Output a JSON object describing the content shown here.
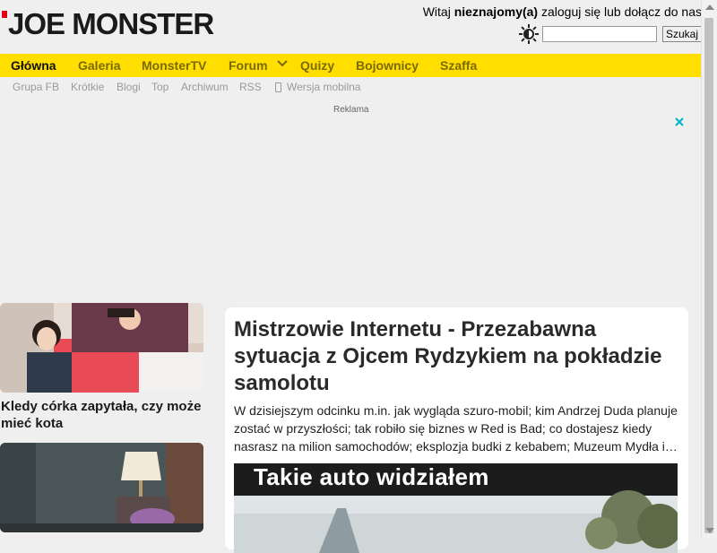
{
  "header": {
    "logo_text": "JOE MONSTER",
    "greeting_prefix": "Witaj",
    "user_name": "nieznajomy(a)",
    "greeting_login": "zaloguj się lub dołącz do nas",
    "search_placeholder": "",
    "search_button": "Szukaj"
  },
  "nav": {
    "items": [
      {
        "label": "Główna",
        "active": true
      },
      {
        "label": "Galeria"
      },
      {
        "label": "MonsterTV"
      },
      {
        "label": "Forum"
      },
      {
        "label": "Quizy"
      },
      {
        "label": "Bojownicy"
      },
      {
        "label": "Szaffa"
      }
    ]
  },
  "subnav": {
    "items": [
      "Grupa FB",
      "Krótkie",
      "Blogi",
      "Top",
      "Archiwum",
      "RSS",
      "Wersja mobilna"
    ]
  },
  "ad": {
    "label": "Reklama"
  },
  "sidebar": {
    "cards": [
      {
        "caption": "Kledy córka zapytała, czy może mieć kota"
      },
      {
        "caption": ""
      }
    ]
  },
  "article": {
    "title": "Mistrzowie Internetu - Przezabawna sytuacja z Ojcem Rydzykiem na pokładzie samolotu",
    "excerpt": "W dzisiejszym odcinku m.in. jak wygląda szuro-mobil; kim Andrzej Duda planuje zostać w przyszłości; tak robiło się biznes w Red is Bad; co dostajesz kiedy nasrasz na milion samochodów; eksplozja budki z kebabem; Muzeum Mydła i…",
    "image_caption": "Takie auto widziałem"
  },
  "colors": {
    "nav_background": "#ffde00",
    "logo_accent": "#e2001a",
    "page_background": "#efefef"
  }
}
